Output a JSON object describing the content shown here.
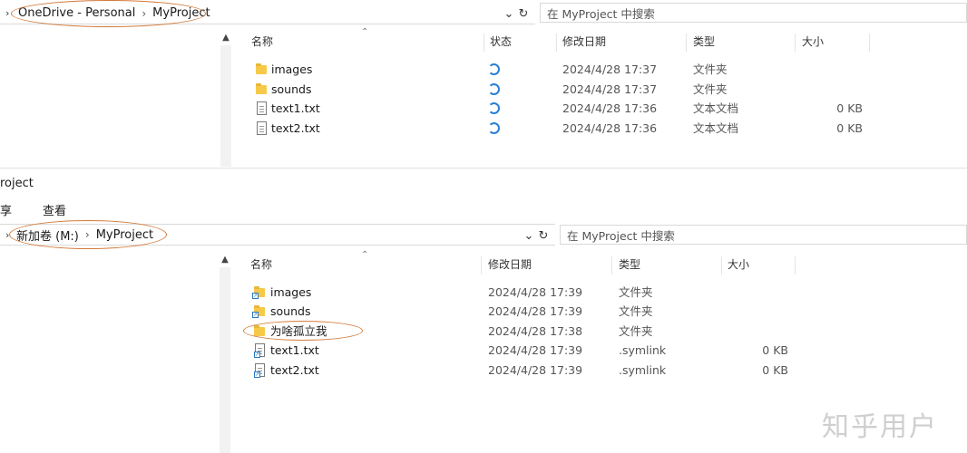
{
  "top": {
    "breadcrumb": [
      "OneDrive - Personal",
      "MyProject"
    ],
    "search_placeholder": "在 MyProject 中搜索",
    "columns": [
      "名称",
      "状态",
      "修改日期",
      "类型",
      "大小"
    ],
    "rows": [
      {
        "name": "images",
        "icon": "folder-icon",
        "status": "sync-icon",
        "date": "2024/4/28 17:37",
        "type": "文件夹",
        "size": ""
      },
      {
        "name": "sounds",
        "icon": "folder-icon",
        "status": "sync-icon",
        "date": "2024/4/28 17:37",
        "type": "文件夹",
        "size": ""
      },
      {
        "name": "text1.txt",
        "icon": "text-file-icon",
        "status": "sync-icon",
        "date": "2024/4/28 17:36",
        "type": "文本文档",
        "size": "0 KB"
      },
      {
        "name": "text2.txt",
        "icon": "text-file-icon",
        "status": "sync-icon",
        "date": "2024/4/28 17:36",
        "type": "文本文档",
        "size": "0 KB"
      }
    ]
  },
  "bottom": {
    "window_title": "roject",
    "menu": [
      "享",
      "查看"
    ],
    "breadcrumb": [
      "新加卷 (M:)",
      "MyProject"
    ],
    "search_placeholder": "在 MyProject 中搜索",
    "columns": [
      "名称",
      "修改日期",
      "类型",
      "大小"
    ],
    "rows": [
      {
        "name": "images",
        "icon": "folder-link-icon",
        "date": "2024/4/28 17:39",
        "type": "文件夹",
        "size": ""
      },
      {
        "name": "sounds",
        "icon": "folder-link-icon",
        "date": "2024/4/28 17:39",
        "type": "文件夹",
        "size": ""
      },
      {
        "name": "为啥孤立我",
        "icon": "folder-icon",
        "date": "2024/4/28 17:38",
        "type": "文件夹",
        "size": ""
      },
      {
        "name": "text1.txt",
        "icon": "symlink-file-icon",
        "date": "2024/4/28 17:39",
        "type": ".symlink",
        "size": "0 KB"
      },
      {
        "name": "text2.txt",
        "icon": "symlink-file-icon",
        "date": "2024/4/28 17:39",
        "type": ".symlink",
        "size": "0 KB"
      }
    ]
  },
  "watermark": "知乎用户",
  "colors": {
    "annotation": "#d27a3a",
    "sync": "#2a7fd4",
    "folder": "#f7c948"
  }
}
